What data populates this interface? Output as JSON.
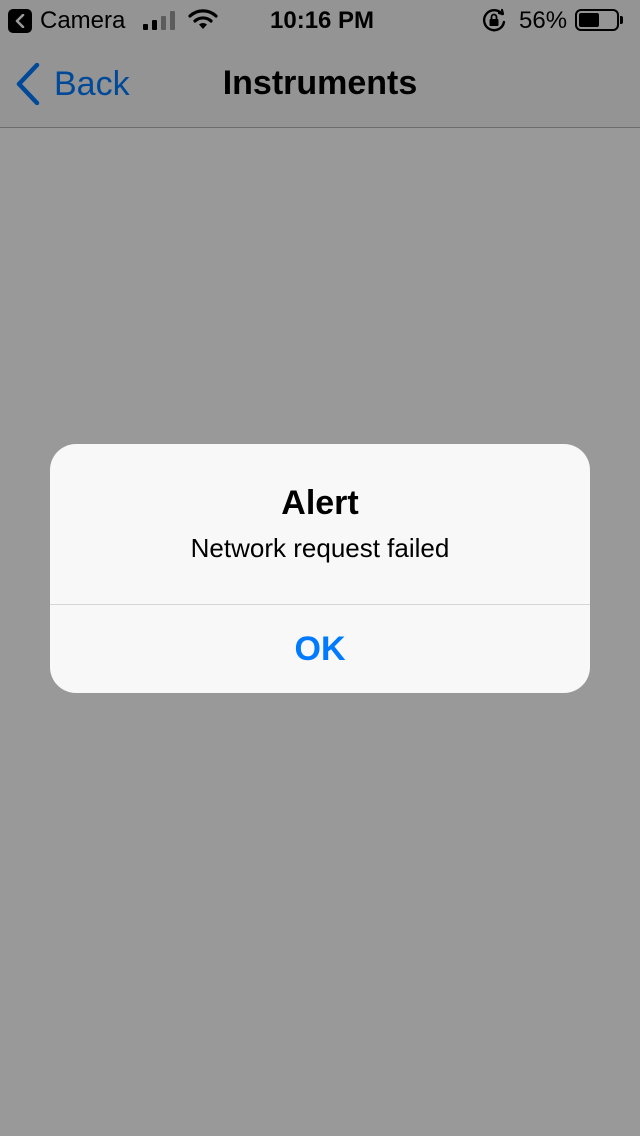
{
  "status_bar": {
    "back_app_label": "Camera",
    "time": "10:16 PM",
    "battery_percent_label": "56%",
    "battery_level": 0.56,
    "signal_bars_filled": 2,
    "signal_bars_total": 4,
    "icons": [
      "back-to-app-icon",
      "cellular-signal-icon",
      "wifi-icon",
      "orientation-lock-icon",
      "battery-icon"
    ]
  },
  "nav": {
    "back_label": "Back",
    "title": "Instruments",
    "back_icon": "chevron-left-icon"
  },
  "alert": {
    "title": "Alert",
    "message": "Network request failed",
    "button_label": "OK"
  },
  "colors": {
    "accent": "#007aff",
    "overlay": "rgba(0,0,0,0.4)",
    "bar_background": "#f7f7f7",
    "alert_background": "#f8f8f8"
  }
}
